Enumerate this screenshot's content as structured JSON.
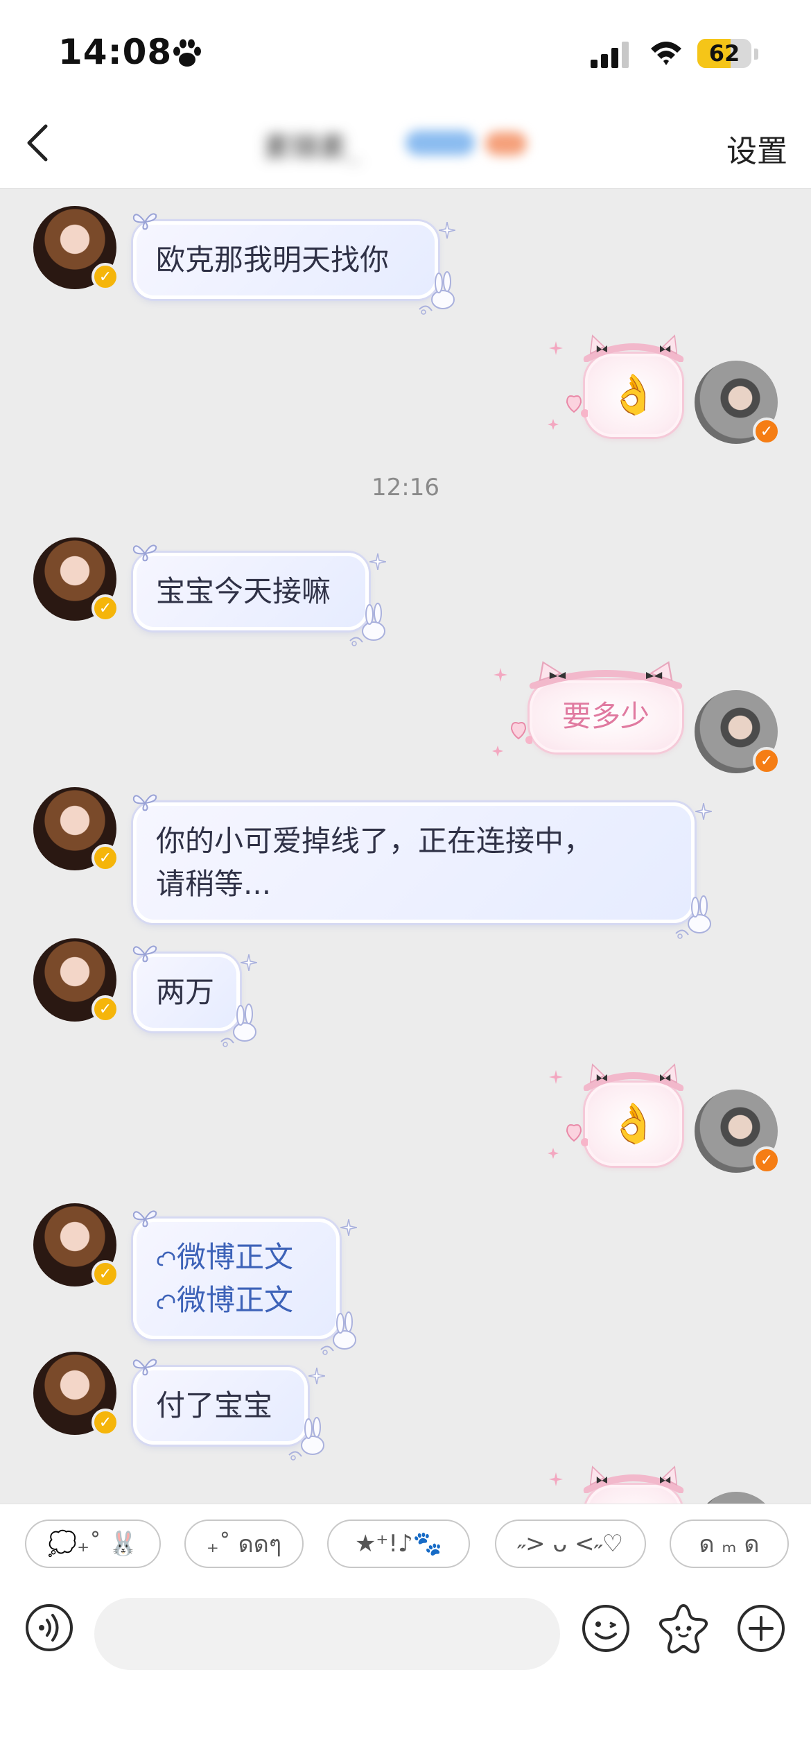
{
  "status_bar": {
    "time": "14:08",
    "time_icon": "paw-icon",
    "battery_level": "62",
    "battery_fraction": 0.62
  },
  "nav": {
    "title": "素锦素_",
    "title_obscured": true,
    "settings_label": "设置",
    "back_icon": "chevron-left-icon"
  },
  "messages": [
    {
      "side": "left",
      "kind": "text",
      "text": "欧克那我明天找你"
    },
    {
      "side": "right",
      "kind": "sticker",
      "icon": "ok-hand-icon",
      "text": "👌"
    },
    {
      "side": "center",
      "kind": "timestamp",
      "text": "12:16"
    },
    {
      "side": "left",
      "kind": "text",
      "text": "宝宝今天接嘛"
    },
    {
      "side": "right",
      "kind": "text",
      "text": "要多少"
    },
    {
      "side": "left",
      "kind": "text",
      "lines": [
        "你的小可爱掉线了，正在连接中，",
        "请稍等..."
      ]
    },
    {
      "side": "left",
      "kind": "text",
      "text": "两万"
    },
    {
      "side": "right",
      "kind": "sticker",
      "icon": "ok-hand-icon",
      "text": "👌"
    },
    {
      "side": "left",
      "kind": "link",
      "lines": [
        "微博正文",
        "微博正文"
      ],
      "link_icon": "weibo-cloud-icon"
    },
    {
      "side": "left",
      "kind": "text",
      "text": "付了宝宝"
    },
    {
      "side": "right",
      "kind": "sticker",
      "icon": "ok-hand-icon",
      "text": "👌"
    }
  ],
  "quick_replies": [
    "💭₊˚ 🐰",
    "₊˚ ดดๆ",
    "★⁺!♪🐾",
    "˶> ᴗ <˶♡",
    "ด ₘ ด"
  ],
  "input": {
    "placeholder": "",
    "value": ""
  },
  "icons": {
    "voice": "voice-icon",
    "emoji": "smiley-icon",
    "sticker": "star-face-icon",
    "more": "plus-circle-icon"
  },
  "colors": {
    "chat_background": "#ececec",
    "bubble_text": "#2f3146",
    "link_text": "#3d62b8",
    "pink_text": "#e07aa0",
    "verified_gold": "#f5b50a",
    "verified_orange": "#f57d14"
  }
}
